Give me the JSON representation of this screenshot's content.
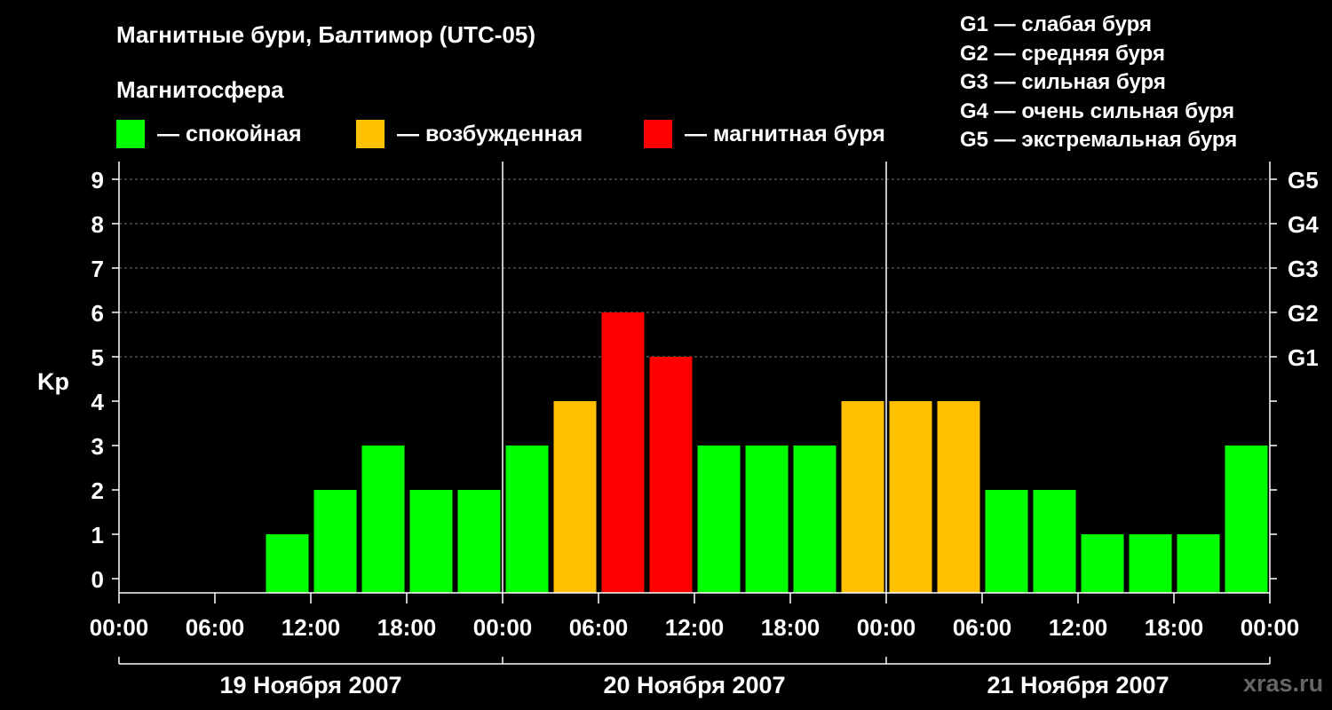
{
  "header": {
    "title": "Магнитные бури, Балтимор (UTC-05)",
    "subtitle": "Магнитосфера"
  },
  "legend": [
    {
      "label": "— спокойная",
      "color": "#00ff00"
    },
    {
      "label": "— возбужденная",
      "color": "#ffc000"
    },
    {
      "label": "— магнитная буря",
      "color": "#ff0000"
    }
  ],
  "storm_levels": [
    "G1 — слабая буря",
    "G2 — средняя буря",
    "G3 — сильная буря",
    "G4 — очень сильная буря",
    "G5 — экстремальная буря"
  ],
  "watermark": "xras.ru",
  "chart_data": {
    "type": "bar",
    "ylabel": "Kp",
    "ylim": [
      0,
      9
    ],
    "y_ticks": [
      "0",
      "1",
      "2",
      "3",
      "4",
      "5",
      "6",
      "7",
      "8",
      "9"
    ],
    "right_ticks": [
      {
        "value": 5,
        "label": "G1"
      },
      {
        "value": 6,
        "label": "G2"
      },
      {
        "value": 7,
        "label": "G3"
      },
      {
        "value": 8,
        "label": "G4"
      },
      {
        "value": 9,
        "label": "G5"
      }
    ],
    "x_tick_labels": [
      "00:00",
      "06:00",
      "12:00",
      "18:00",
      "00:00",
      "06:00",
      "12:00",
      "18:00",
      "00:00",
      "06:00",
      "12:00",
      "18:00",
      "00:00"
    ],
    "days": [
      "19 Ноября 2007",
      "20 Ноября 2007",
      "21 Ноября 2007"
    ],
    "interval_hours": 3,
    "bars": [
      {
        "day": "19 Ноября 2007",
        "start": "00:00",
        "kp": null,
        "level": null
      },
      {
        "day": "19 Ноября 2007",
        "start": "03:00",
        "kp": null,
        "level": null
      },
      {
        "day": "19 Ноября 2007",
        "start": "06:00",
        "kp": null,
        "level": null
      },
      {
        "day": "19 Ноября 2007",
        "start": "09:00",
        "kp": 1,
        "level": "quiet"
      },
      {
        "day": "19 Ноября 2007",
        "start": "12:00",
        "kp": 2,
        "level": "quiet"
      },
      {
        "day": "19 Ноября 2007",
        "start": "15:00",
        "kp": 3,
        "level": "quiet"
      },
      {
        "day": "19 Ноября 2007",
        "start": "18:00",
        "kp": 2,
        "level": "quiet"
      },
      {
        "day": "19 Ноября 2007",
        "start": "21:00",
        "kp": 2,
        "level": "quiet"
      },
      {
        "day": "20 Ноября 2007",
        "start": "00:00",
        "kp": 3,
        "level": "quiet"
      },
      {
        "day": "20 Ноября 2007",
        "start": "03:00",
        "kp": 4,
        "level": "active"
      },
      {
        "day": "20 Ноября 2007",
        "start": "06:00",
        "kp": 6,
        "level": "storm"
      },
      {
        "day": "20 Ноября 2007",
        "start": "09:00",
        "kp": 5,
        "level": "storm"
      },
      {
        "day": "20 Ноября 2007",
        "start": "12:00",
        "kp": 3,
        "level": "quiet"
      },
      {
        "day": "20 Ноября 2007",
        "start": "15:00",
        "kp": 3,
        "level": "quiet"
      },
      {
        "day": "20 Ноября 2007",
        "start": "18:00",
        "kp": 3,
        "level": "quiet"
      },
      {
        "day": "20 Ноября 2007",
        "start": "21:00",
        "kp": 4,
        "level": "active"
      },
      {
        "day": "21 Ноября 2007",
        "start": "00:00",
        "kp": 4,
        "level": "active"
      },
      {
        "day": "21 Ноября 2007",
        "start": "03:00",
        "kp": 4,
        "level": "active"
      },
      {
        "day": "21 Ноября 2007",
        "start": "06:00",
        "kp": 2,
        "level": "quiet"
      },
      {
        "day": "21 Ноября 2007",
        "start": "09:00",
        "kp": 2,
        "level": "quiet"
      },
      {
        "day": "21 Ноября 2007",
        "start": "12:00",
        "kp": 1,
        "level": "quiet"
      },
      {
        "day": "21 Ноября 2007",
        "start": "15:00",
        "kp": 1,
        "level": "quiet"
      },
      {
        "day": "21 Ноября 2007",
        "start": "18:00",
        "kp": 1,
        "level": "quiet"
      },
      {
        "day": "21 Ноября 2007",
        "start": "21:00",
        "kp": 3,
        "level": "quiet"
      }
    ],
    "level_colors": {
      "quiet": "#00ff00",
      "active": "#ffc000",
      "storm": "#ff0000"
    },
    "grid": "dashed horizontal at 5–9",
    "legend_position": "top"
  }
}
